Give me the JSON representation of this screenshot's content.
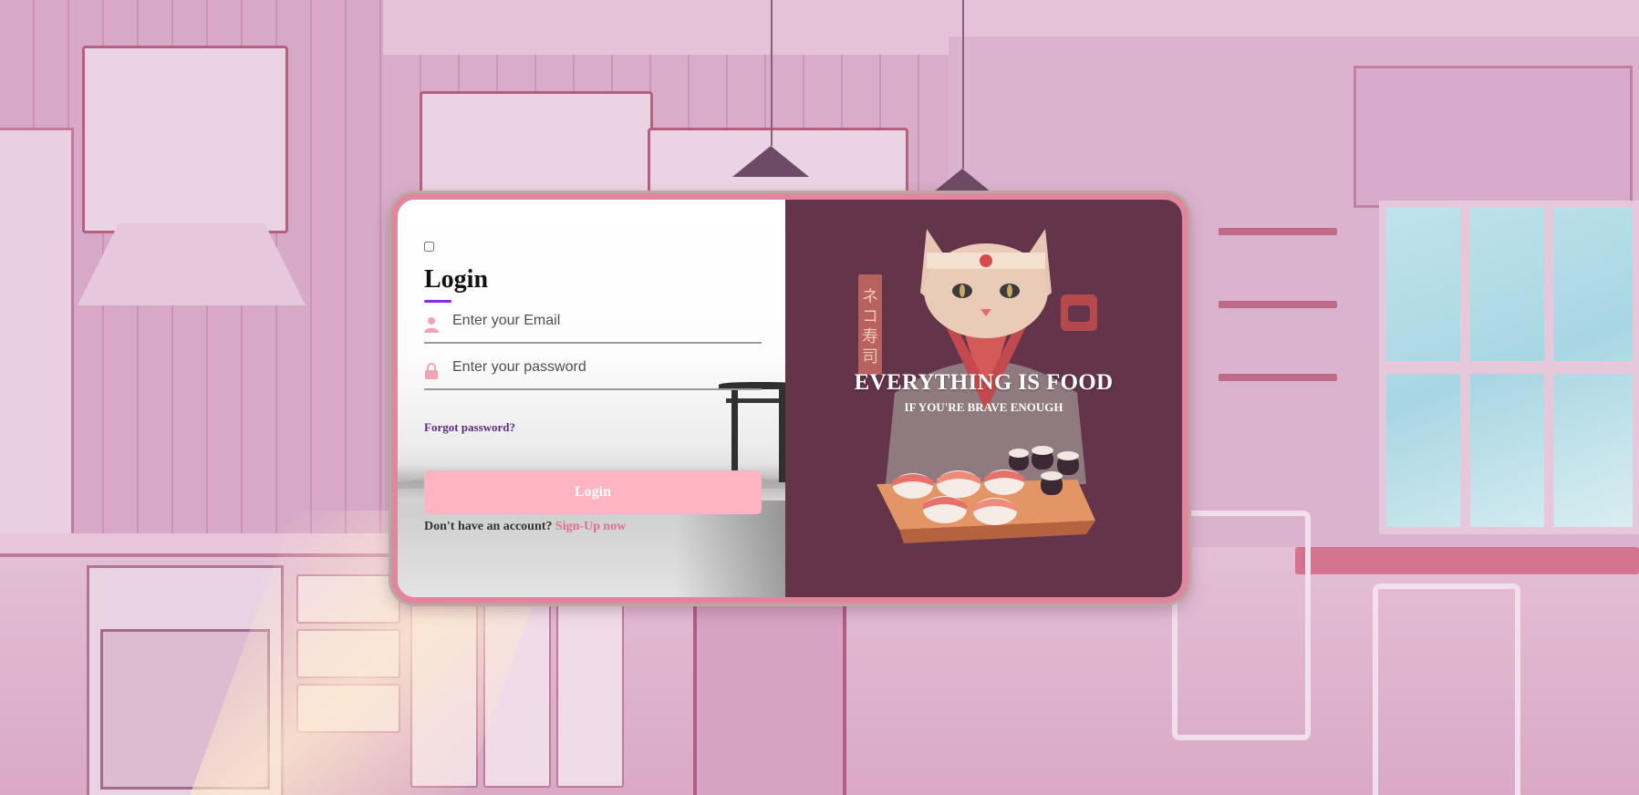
{
  "login": {
    "title": "Login",
    "email_placeholder": "Enter your Email",
    "password_placeholder": "Enter your password",
    "forgot_label": "Forgot password?",
    "submit_label": "Login",
    "signup_prompt": "Don't have an account?",
    "signup_link": "Sign-Up now",
    "accent_color": "#8a2be2",
    "button_color": "#ffb4c2",
    "link_color": "#e06f8f"
  },
  "hero": {
    "title": "EVERYTHING IS FOOD",
    "subtitle": "IF YOU'RE BRAVE ENOUGH",
    "panel_color": "#64344a"
  },
  "icons": {
    "email": "user-icon",
    "password": "lock-icon"
  }
}
